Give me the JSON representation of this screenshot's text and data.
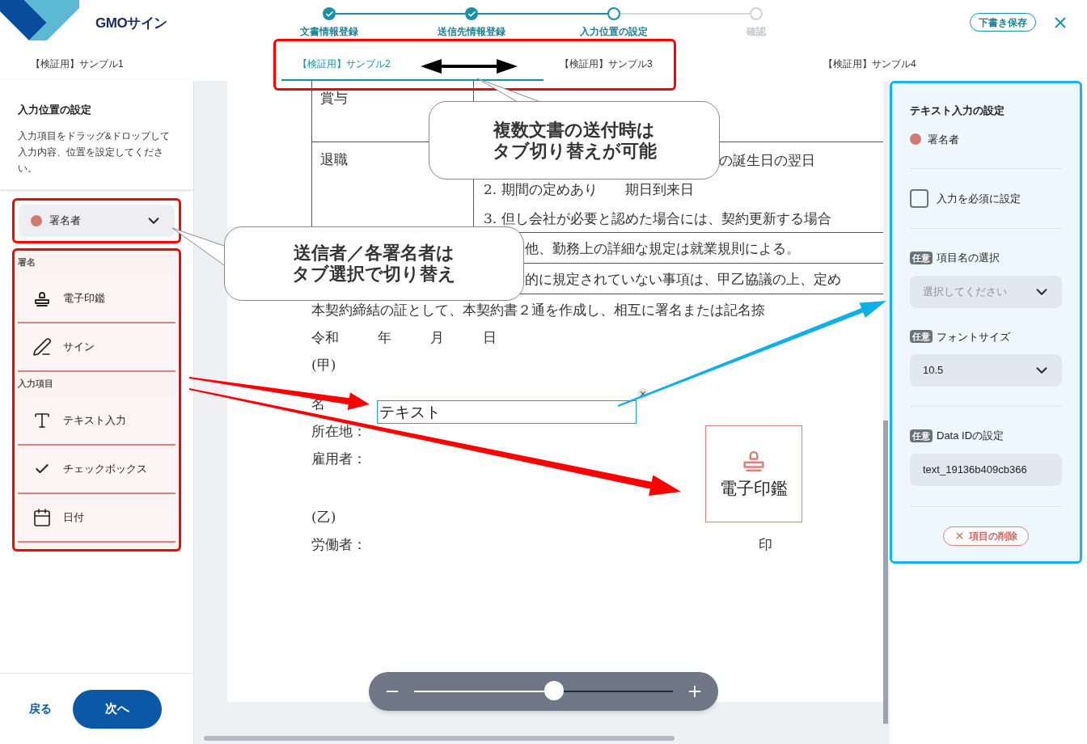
{
  "header": {
    "logo_text": "GMOサイン",
    "save_draft": "下書き保存",
    "steps": [
      {
        "label": "文書情報登録",
        "kind": "done"
      },
      {
        "label": "送信先情報登録",
        "kind": "done"
      },
      {
        "label": "入力位置の設定",
        "kind": "current"
      },
      {
        "label": "確認",
        "kind": "pending"
      }
    ]
  },
  "tabs": [
    {
      "label": "【検証用】サンプル1",
      "selected": false
    },
    {
      "label": "【検証用】サンプル2",
      "selected": true
    },
    {
      "label": "【検証用】サンプル3",
      "selected": false
    },
    {
      "label": "【検証用】サンプル4",
      "selected": false
    }
  ],
  "sidebar": {
    "title": "入力位置の設定",
    "description": "入力項目をドラッグ&ドロップして入力内容、位置を設定してください。",
    "signer": {
      "name": "署名者",
      "color": "#d07a74"
    },
    "groups": [
      {
        "heading": "署名",
        "items": [
          {
            "label": "電子印鑑",
            "kind": "stamp"
          },
          {
            "label": "サイン",
            "kind": "pen"
          }
        ]
      },
      {
        "heading": "入力項目",
        "items": [
          {
            "label": "テキスト入力",
            "kind": "text"
          },
          {
            "label": "チェックボックス",
            "kind": "check"
          },
          {
            "label": "日付",
            "kind": "calendar"
          }
        ]
      }
    ],
    "back": "戻る",
    "next": "次へ"
  },
  "document": {
    "rows": [
      {
        "label": "賞与",
        "lines": []
      },
      {
        "label": "退職",
        "lines": [
          "の誕生日の翌日",
          "2. 期間の定めあり　　期日到来日",
          "3. 但し会社が必要と認めた場合には、契約更新する場合"
        ]
      }
    ],
    "notes": [
      "他、勤務上の詳細な規定は就業規則による。",
      "的に規定されていない事項は、甲乙協議の上、定め"
    ],
    "closing": "本契約締結の証として、本契約書２通を作成し、相互に署名または記名捺",
    "date_parts": [
      "令和",
      "年",
      "月",
      "日"
    ],
    "party_a": "(甲)",
    "name_label": "名",
    "address_label": "所在地：",
    "employer_label": "雇用者：",
    "party_b": "(乙)",
    "worker_label": "労働者：",
    "seal_mark": "印",
    "text_field": "テキスト",
    "stamp_field": "電子印鑑"
  },
  "zoom": {
    "level": 0.54
  },
  "settings": {
    "title": "テキスト入力の設定",
    "signer": {
      "name": "署名者",
      "color": "#d07a74"
    },
    "required": {
      "label": "入力を必須に設定",
      "checked": false
    },
    "fields": [
      {
        "badge": "任意",
        "label": "項目名の選択",
        "kind": "select",
        "placeholder": "選択してください"
      },
      {
        "badge": "任意",
        "label": "フォントサイズ",
        "kind": "select",
        "value": "10.5"
      },
      {
        "badge": "任意",
        "label": "Data IDの設定",
        "kind": "input",
        "value": "text_19136b409cb366"
      }
    ],
    "delete": "項目の削除"
  },
  "annotations": {
    "callouts": [
      {
        "lines": [
          "複数文書の送付時は",
          "タブ切り替えが可能"
        ]
      },
      {
        "lines": [
          "送信者／各署名者は",
          "タブ選択で切り替え"
        ]
      }
    ]
  }
}
